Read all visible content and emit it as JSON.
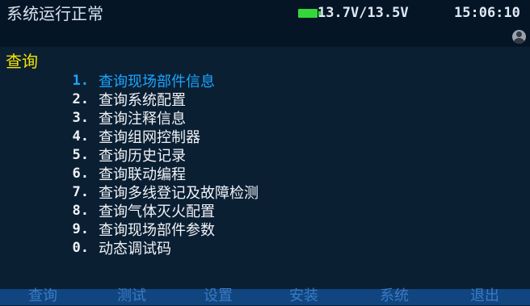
{
  "status": {
    "text": "系统运行正常",
    "voltage": "13.7V/13.5V",
    "time": "15:06:10",
    "colors": {
      "battery": "#35d63b",
      "header_bg": "#061526"
    },
    "icons": {
      "battery": "battery-icon",
      "user": "user-icon"
    }
  },
  "section": {
    "title": "查询"
  },
  "menu": {
    "selected_color": "#1aa6ff",
    "items": [
      {
        "num": "1.",
        "label": "查询现场部件信息"
      },
      {
        "num": "2.",
        "label": "查询系统配置"
      },
      {
        "num": "3.",
        "label": "查询注释信息"
      },
      {
        "num": "4.",
        "label": "查询组网控制器"
      },
      {
        "num": "5.",
        "label": "查询历史记录"
      },
      {
        "num": "6.",
        "label": "查询联动编程"
      },
      {
        "num": "7.",
        "label": "查询多线登记及故障检测"
      },
      {
        "num": "8.",
        "label": "查询气体灭火配置"
      },
      {
        "num": "9.",
        "label": "查询现场部件参数"
      },
      {
        "num": "0.",
        "label": "动态调试码"
      }
    ]
  },
  "footer": {
    "tabs": [
      "查询",
      "测试",
      "设置",
      "安装",
      "系统",
      "退出"
    ]
  }
}
